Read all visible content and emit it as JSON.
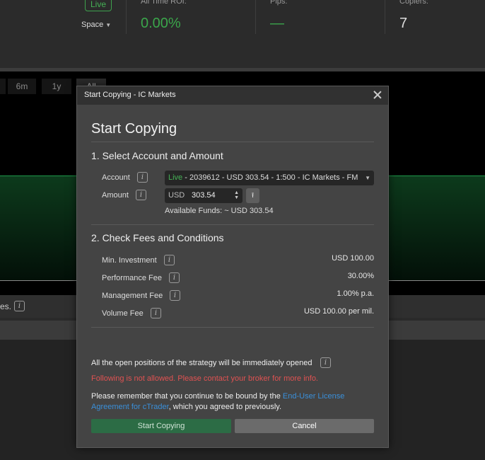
{
  "background": {
    "live_badge": "Live",
    "space_selector": "Space",
    "stats": [
      {
        "label": "All Time ROI:",
        "value": "0.00%"
      },
      {
        "label": "Pips:",
        "value": "—"
      },
      {
        "label": "Copiers:",
        "value": "7"
      }
    ],
    "timeframes": [
      "6m",
      "1y",
      "All"
    ],
    "row_text": "es."
  },
  "modal": {
    "window_title": "Start Copying - IC Markets",
    "heading": "Start Copying",
    "section1_title": "1. Select Account and Amount",
    "account_label": "Account",
    "account_live": "Live",
    "account_value": " - 2039612 - USD 303.54 - 1:500 - IC Markets - FM",
    "amount_label": "Amount",
    "amount_currency": "USD",
    "amount_value": "303.54",
    "available_funds_label": "Available Funds:",
    "available_funds_value": "~ USD 303.54",
    "section2_title": "2. Check Fees and Conditions",
    "fees": [
      {
        "label": "Min. Investment",
        "value": "USD 100.00"
      },
      {
        "label": "Performance Fee",
        "value": "30.00%"
      },
      {
        "label": "Management Fee",
        "value": "1.00% p.a."
      },
      {
        "label": "Volume Fee",
        "value": "USD 100.00 per mil."
      }
    ],
    "positions_note": "All the open positions of the strategy will be immediately opened",
    "not_allowed_warning": "Following is not allowed. Please contact your broker for more info.",
    "license_prefix": "Please remember that you continue to be bound by the ",
    "license_link": "End-User License Agreement for cTrader",
    "license_suffix": ", which you agreed to previously.",
    "start_button": "Start Copying",
    "cancel_button": "Cancel",
    "info_glyph": "i"
  },
  "colors": {
    "accent_green": "#45b055",
    "warning_red": "#e05252",
    "link_blue": "#3a8fd9",
    "modal_bg": "#444444"
  }
}
